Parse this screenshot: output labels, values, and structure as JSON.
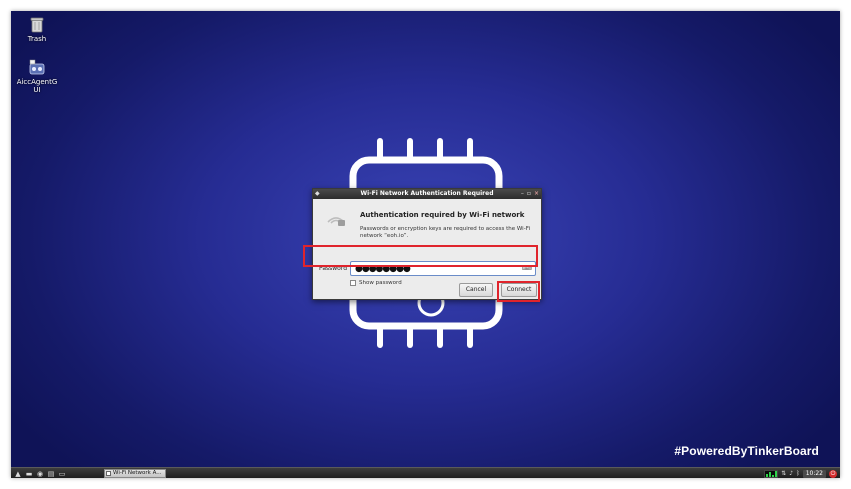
{
  "desktop": {
    "icons": [
      {
        "label": "Trash",
        "icon": "trash-icon"
      },
      {
        "label": "AiccAgentG UI",
        "icon": "agent-app-icon"
      }
    ],
    "brand_text": "#PoweredByTinkerBoard",
    "wallpaper_colors": {
      "center": "#3a44b6",
      "edge": "#0f1357"
    }
  },
  "dialog": {
    "title": "Wi-Fi Network Authentication Required",
    "heading": "Authentication required by Wi-Fi network",
    "body": "Passwords or encryption keys are required to access the Wi-Fi network “eoh.io”.",
    "password_label": "Password",
    "password_value": "●●●●●●●●",
    "show_password_label": "Show password",
    "show_password_checked": false,
    "cancel_label": "Cancel",
    "connect_label": "Connect",
    "titlebar_buttons": [
      "minimize-icon",
      "maximize-icon",
      "close-icon"
    ]
  },
  "annotations": {
    "highlight_color": "#e0242c"
  },
  "taskbar": {
    "launcher_icons": [
      "menu-icon",
      "terminal-icon",
      "browser-icon",
      "files-icon",
      "desktop-icon"
    ],
    "task_label": "Wi-Fi Network A...",
    "clock": "10:22",
    "tray_icons": [
      "network-icon",
      "volume-icon",
      "bluetooth-icon",
      "shutdown-icon"
    ]
  }
}
